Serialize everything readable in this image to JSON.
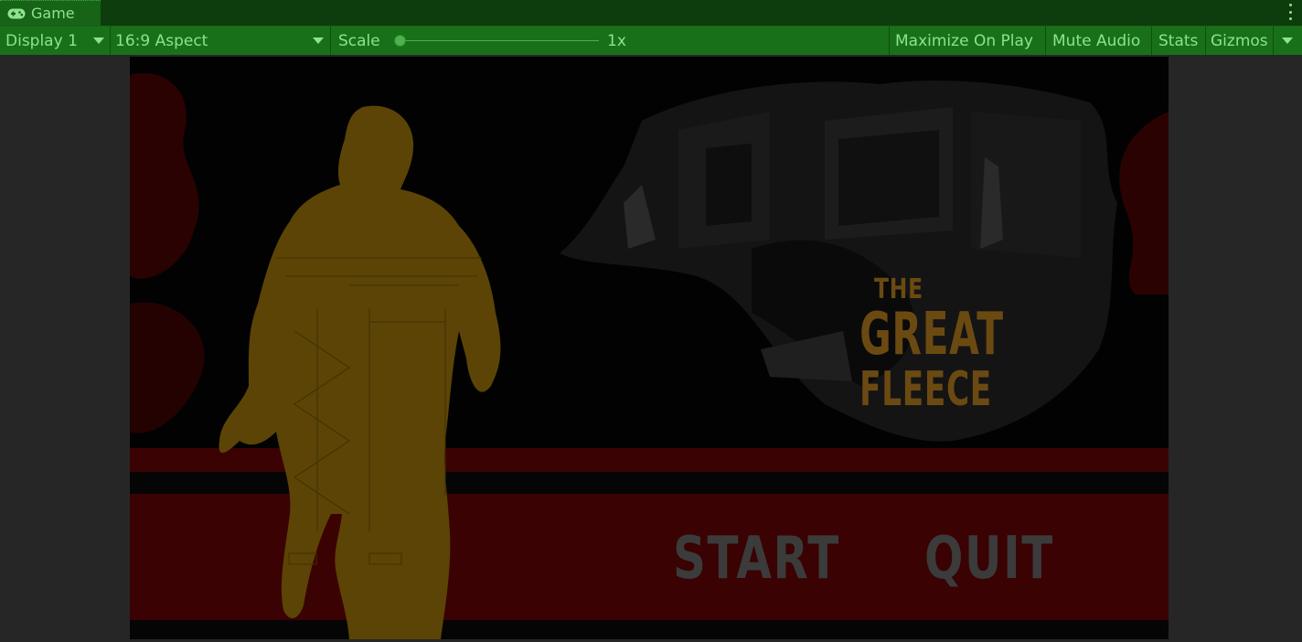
{
  "tab": {
    "label": "Game",
    "icon": "gamepad-icon"
  },
  "toolbar": {
    "display": "Display 1",
    "aspect": "16:9 Aspect",
    "scale_label": "Scale",
    "scale_value": "1x",
    "scale_slider_fraction": 0.0,
    "maximize": "Maximize On Play",
    "mute": "Mute Audio",
    "stats": "Stats",
    "gizmos": "Gizmos"
  },
  "game": {
    "title_line1": "THE",
    "title_line2": "GREAT",
    "title_line3": "FLEECE",
    "start": "START",
    "quit": "QUIT"
  },
  "colors": {
    "editor_tint": "#187118",
    "title": "#6b4a12",
    "silhouette": "#5b4405",
    "red_band": "#3a0202"
  }
}
